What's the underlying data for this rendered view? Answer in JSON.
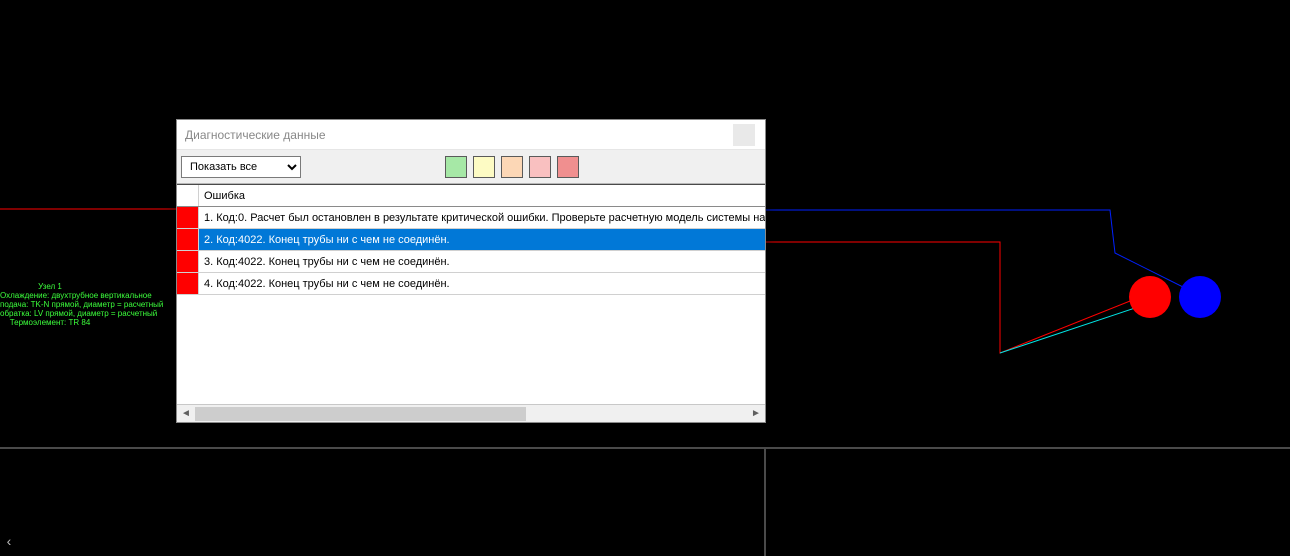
{
  "dialog": {
    "title": "Диагностические данные",
    "close_label": "",
    "filter_options": [
      "Показать все"
    ],
    "filter_selected": "Показать все",
    "swatches": [
      "#a6e8a6",
      "#fdfbc4",
      "#fcd7b6",
      "#f9c0c0",
      "#f08f8f"
    ],
    "header": "Ошибка",
    "rows": [
      {
        "marker": "#ff0000",
        "text": "1. Код:0. Расчет был остановлен в результате критической ошибки. Проверьте расчетную модель системы на",
        "selected": false
      },
      {
        "marker": "#ff0000",
        "text": "2. Код:4022. Конец трубы ни с чем не соединён.",
        "selected": true
      },
      {
        "marker": "#ff0000",
        "text": "3. Код:4022. Конец трубы ни с чем не соединён.",
        "selected": false
      },
      {
        "marker": "#ff0000",
        "text": "4. Код:4022. Конец трубы ни с чем не соединён.",
        "selected": false
      }
    ]
  },
  "node_info": {
    "lines": [
      "Узел 1",
      "Охлаждение: двухтрубное вертикальное",
      "подача: TK-N прямой, диаметр = расчетный",
      "обратка: LV прямой, диаметр = расчетный",
      "Термоэлемент: TR 84"
    ]
  },
  "schematic": {
    "red_node_color": "#ff0000",
    "blue_node_color": "#0000ff",
    "line_red": "#ff0000",
    "line_blue": "#0020ff",
    "line_cyan": "#00e5e5",
    "divider_gray": "#4a4a4a"
  }
}
